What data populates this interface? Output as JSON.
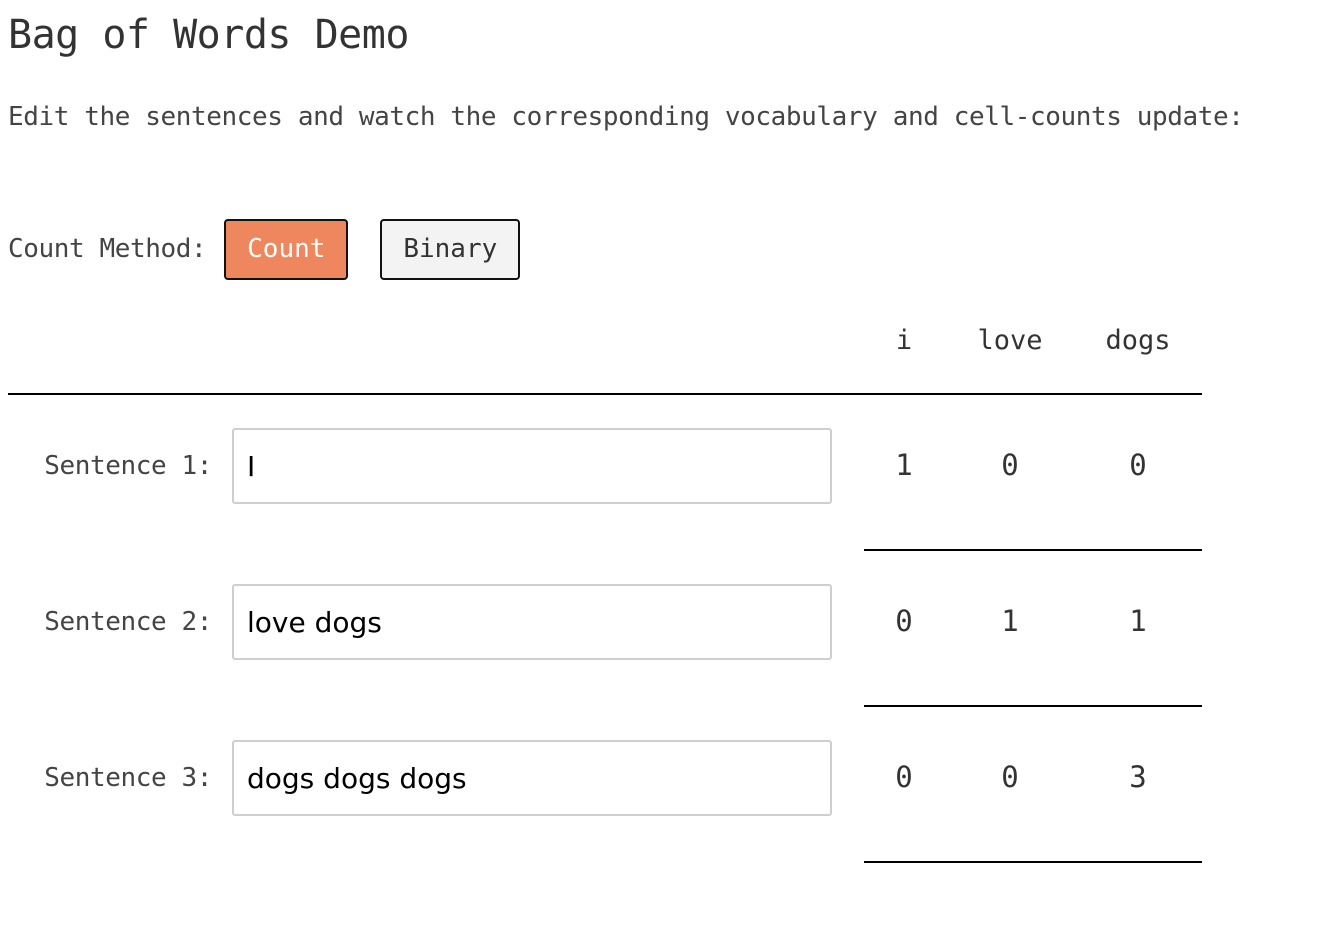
{
  "header": {
    "title": "Bag of Words Demo",
    "subtitle": "Edit the sentences and watch the corresponding vocabulary and cell-counts update:"
  },
  "count_method": {
    "label": "Count Method:",
    "options": [
      {
        "label": "Count",
        "selected": true
      },
      {
        "label": "Binary",
        "selected": false
      }
    ],
    "active_color": "#EF875E"
  },
  "vocabulary": [
    "i",
    "love",
    "dogs"
  ],
  "sentences": [
    {
      "label": "Sentence 1:",
      "value": "I",
      "counts": [
        "1",
        "0",
        "0"
      ]
    },
    {
      "label": "Sentence 2:",
      "value": "love dogs",
      "counts": [
        "0",
        "1",
        "1"
      ]
    },
    {
      "label": "Sentence 3:",
      "value": "dogs dogs dogs",
      "counts": [
        "0",
        "0",
        "3"
      ]
    }
  ]
}
